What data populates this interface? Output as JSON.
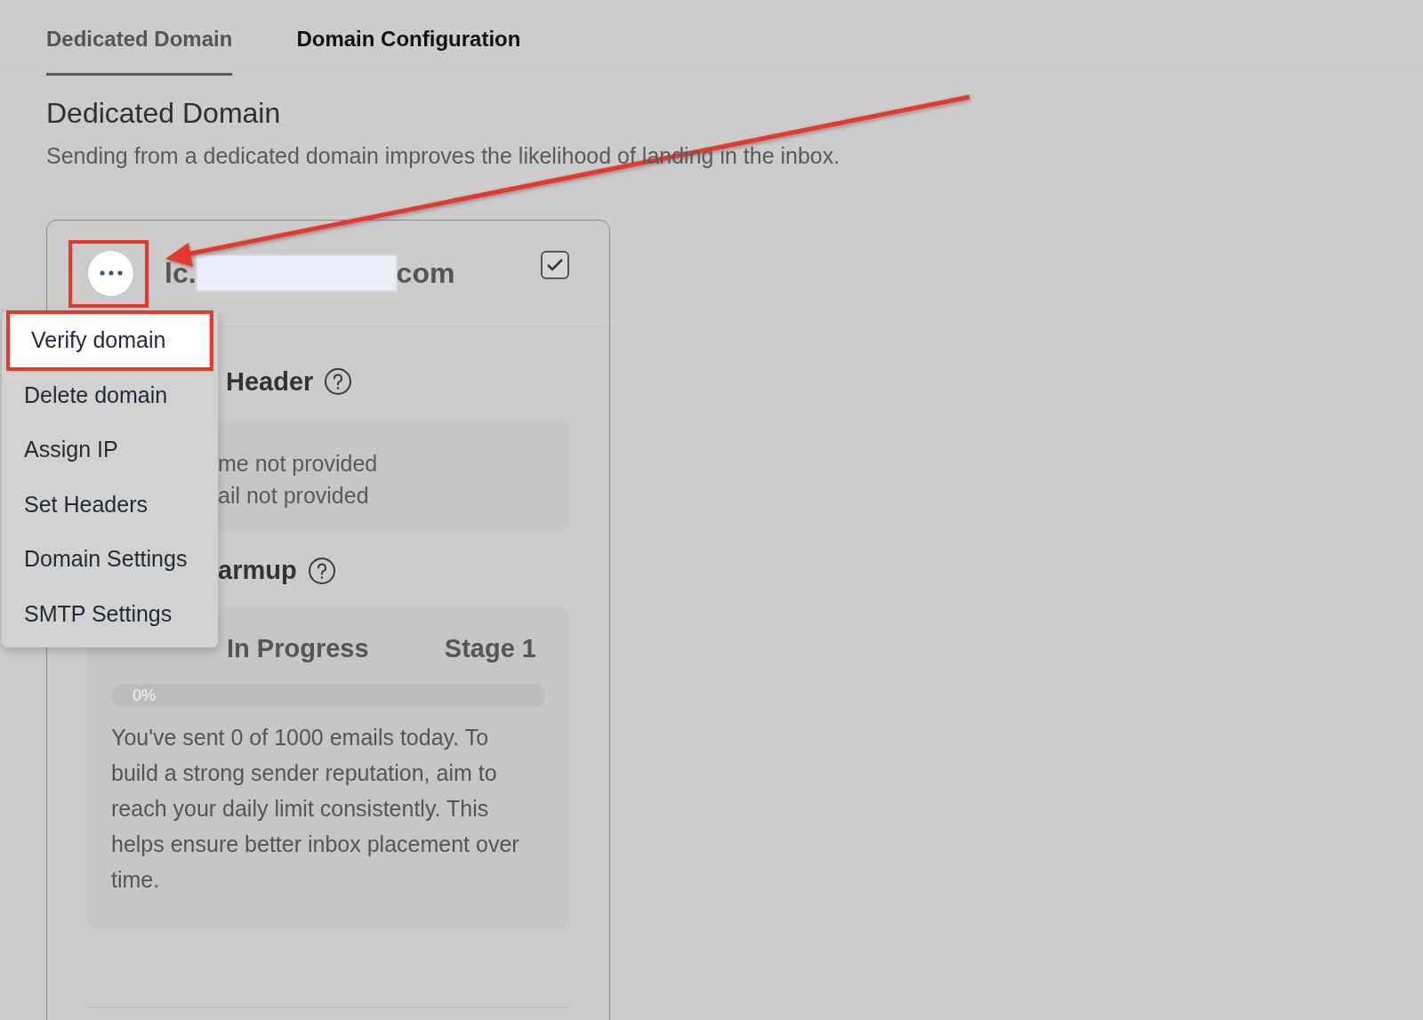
{
  "tabs": [
    {
      "label": "Dedicated Domain",
      "selected": true
    },
    {
      "label": "Domain Configuration",
      "selected": false
    }
  ],
  "page": {
    "title": "Dedicated Domain",
    "subtitle": "Sending from a dedicated domain improves the likelihood of landing in the inbox."
  },
  "domain_card": {
    "name_start": "lc.",
    "name_end": "com",
    "checked": true,
    "header_section": {
      "title": "Header",
      "lines": [
        "me not provided",
        "ail not provided"
      ]
    },
    "warmup_section": {
      "title": "armup",
      "status": "In Progress",
      "stage": "Stage 1",
      "progress": {
        "level": 0,
        "label": "0%"
      },
      "message": "You've sent 0 of 1000 emails today. To build a strong sender reputation, aim to reach your daily limit consistently. This helps ensure better inbox placement over time."
    }
  },
  "menu": {
    "items": [
      {
        "label": "Verify domain",
        "selected": true
      },
      {
        "label": "Delete domain",
        "selected": false
      },
      {
        "label": "Assign IP",
        "selected": false
      },
      {
        "label": "Set Headers",
        "selected": false
      },
      {
        "label": "Domain Settings",
        "selected": false
      },
      {
        "label": "SMTP Settings",
        "selected": false
      }
    ]
  }
}
